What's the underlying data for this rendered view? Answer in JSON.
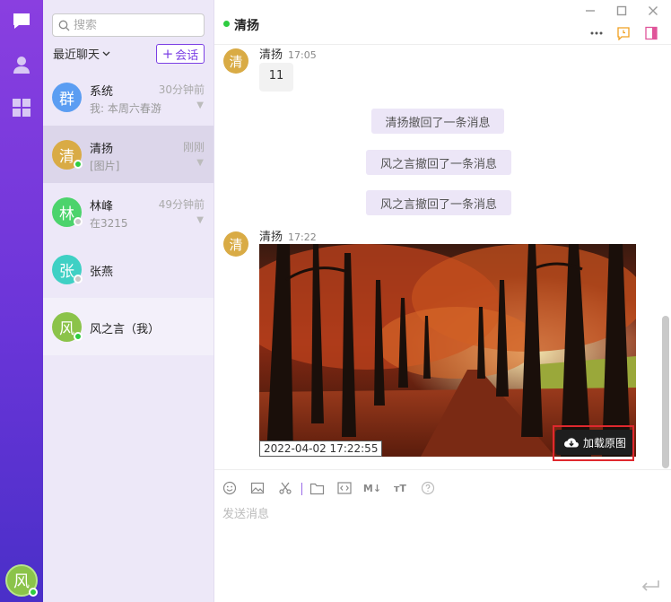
{
  "search": {
    "placeholder": "搜索"
  },
  "list_header": {
    "recent_label": "最近聊天",
    "new_session_label": "会话"
  },
  "contacts": [
    {
      "avatar_char": "群",
      "name": "系统",
      "time": "30分钟前",
      "preview": "我: 本周六春游",
      "color": "#5b9df2"
    },
    {
      "avatar_char": "清",
      "name": "清扬",
      "time": "刚刚",
      "preview": "[图片]",
      "color": "#d9ab45"
    },
    {
      "avatar_char": "林",
      "name": "林峰",
      "time": "49分钟前",
      "preview": "在3215",
      "color": "#4cd36c"
    },
    {
      "avatar_char": "张",
      "name": "张燕",
      "time": "",
      "preview": "",
      "color": "#3fd0c4"
    },
    {
      "avatar_char": "风",
      "name": "风之言（我）",
      "time": "",
      "preview": "",
      "color": "#8bc34a"
    }
  ],
  "self_avatar_char": "风",
  "chat": {
    "title": "清扬",
    "messages": [
      {
        "avatar_char": "清",
        "sender": "清扬",
        "time": "17:05",
        "text": "11"
      },
      {
        "avatar_char": "清",
        "sender": "清扬",
        "time": "17:22"
      }
    ],
    "notices": [
      "清扬撤回了一条消息",
      "风之言撤回了一条消息",
      "风之言撤回了一条消息"
    ],
    "image": {
      "timestamp": "2022-04-02 17:22:55",
      "load_label": "加载原图"
    }
  },
  "toolbar": {
    "markdown_label": "M↓",
    "format_label": "ᴛT"
  },
  "composer": {
    "placeholder": "发送消息"
  },
  "colors": {
    "accent": "#7b3fe4",
    "online": "#2ecc40",
    "highlight": "#e0282e"
  }
}
